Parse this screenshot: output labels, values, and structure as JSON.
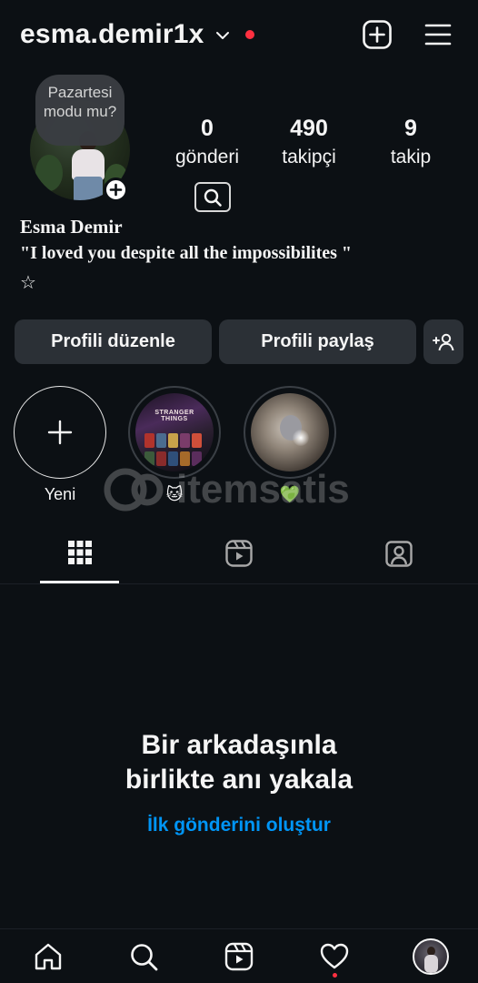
{
  "header": {
    "username": "esma.demir1x",
    "icons": {
      "switch": "chevron-down-icon",
      "create": "plus-square-icon",
      "menu": "hamburger-menu-icon"
    },
    "notification_color": "#ff3040"
  },
  "profile": {
    "note": "Pazartesi modu mu?",
    "stats": [
      {
        "value": "0",
        "label": "gönderi"
      },
      {
        "value": "490",
        "label": "takipçi"
      },
      {
        "value": "9",
        "label": "takip"
      }
    ],
    "full_name": "Esma Demir",
    "bio": "\"I loved you despite all the impossibilites \"",
    "bio_symbol": "☆"
  },
  "actions": {
    "edit_label": "Profili düzenle",
    "share_label": "Profili paylaş",
    "add_person_icon": "add-person-icon"
  },
  "highlights": [
    {
      "label": "Yeni"
    },
    {
      "label": "🐱"
    },
    {
      "label": "💚"
    }
  ],
  "highlight_art_text": "STRANGER THINGS",
  "watermark": "itemsatis",
  "tabs": [
    {
      "icon": "grid-icon",
      "active": true
    },
    {
      "icon": "reels-icon",
      "active": false
    },
    {
      "icon": "tagged-icon",
      "active": false
    }
  ],
  "empty_state": {
    "title": "Bir arkadaşınla birlikte anı yakala",
    "link": "İlk gönderini oluştur"
  },
  "bottom_nav": [
    "home-icon",
    "search-icon",
    "reels-icon",
    "heart-icon",
    "profile-avatar"
  ],
  "colors": {
    "background": "#0c1014",
    "button": "#2b3036",
    "link": "#0095f6",
    "alert": "#ff3040"
  }
}
